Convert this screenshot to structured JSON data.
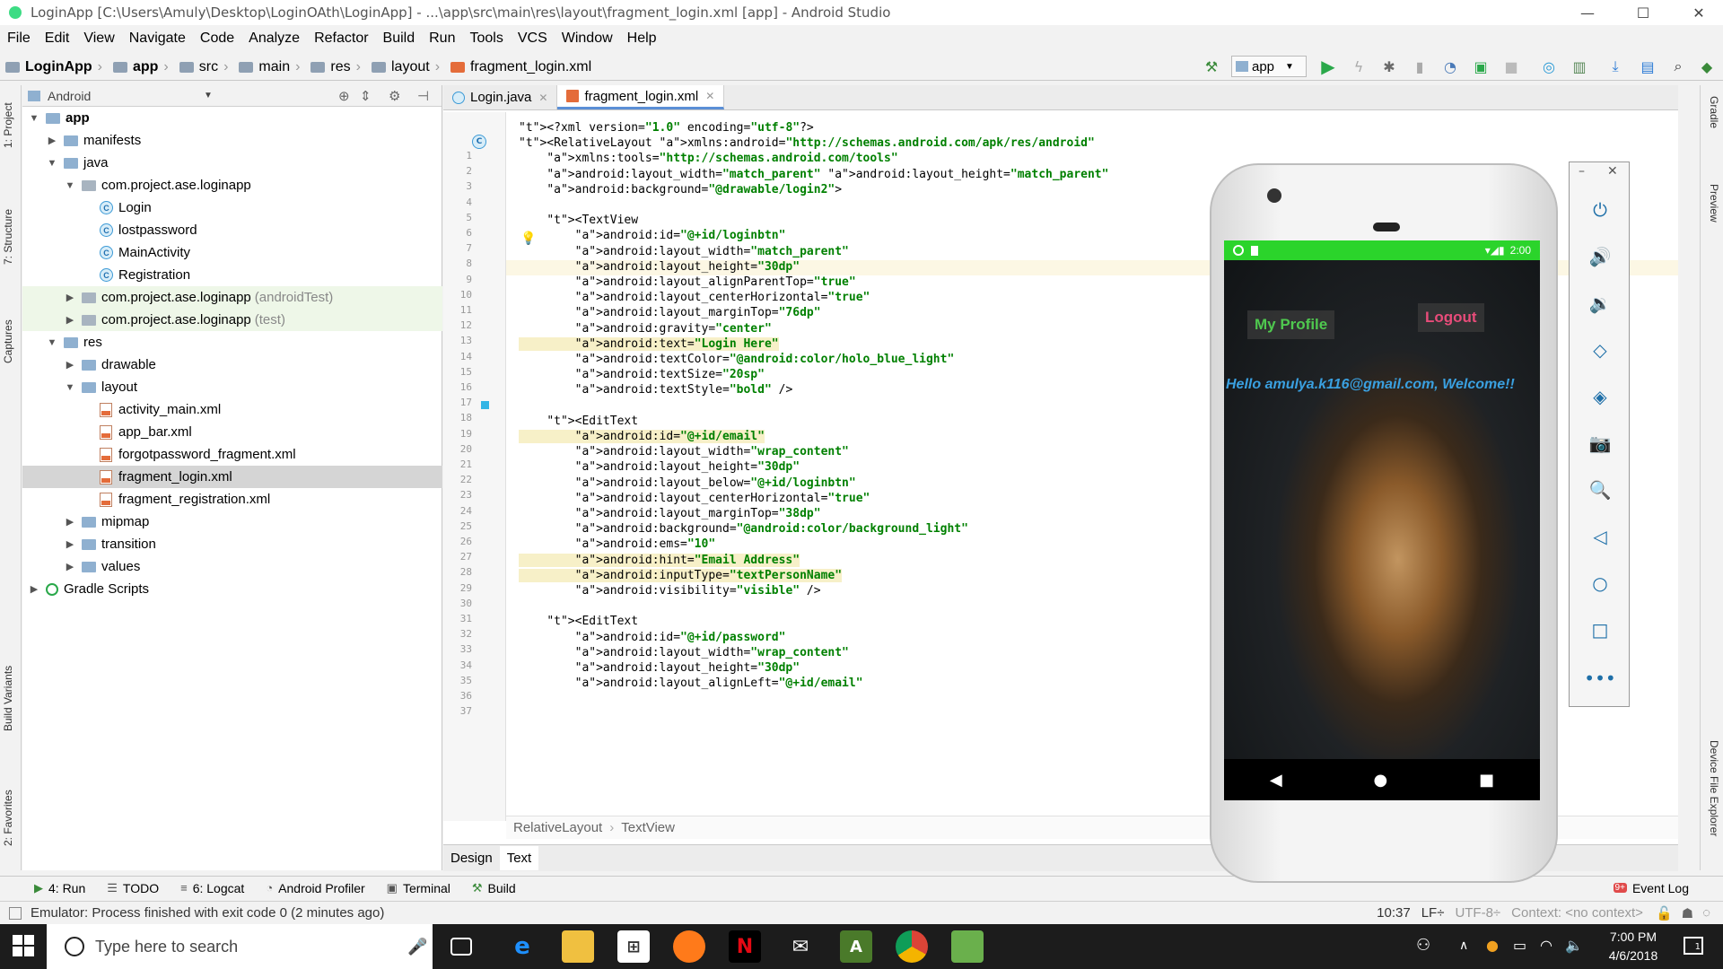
{
  "window": {
    "title": "LoginApp [C:\\Users\\Amuly\\Desktop\\LoginOAth\\LoginApp] - ...\\app\\src\\main\\res\\layout\\fragment_login.xml [app] - Android Studio"
  },
  "menu": [
    "File",
    "Edit",
    "View",
    "Navigate",
    "Code",
    "Analyze",
    "Refactor",
    "Build",
    "Run",
    "Tools",
    "VCS",
    "Window",
    "Help"
  ],
  "breadcrumb": [
    "LoginApp",
    "app",
    "src",
    "main",
    "res",
    "layout",
    "fragment_login.xml"
  ],
  "run_config": "app",
  "project_panel": {
    "view_mode": "Android",
    "tree": [
      {
        "label": "app",
        "type": "module",
        "level": 0,
        "expanded": true
      },
      {
        "label": "manifests",
        "type": "folder",
        "level": 1,
        "expanded": false
      },
      {
        "label": "java",
        "type": "folder",
        "level": 1,
        "expanded": true
      },
      {
        "label": "com.project.ase.loginapp",
        "type": "package",
        "level": 2,
        "expanded": true
      },
      {
        "label": "Login",
        "type": "class",
        "level": 3
      },
      {
        "label": "lostpassword",
        "type": "class",
        "level": 3
      },
      {
        "label": "MainActivity",
        "type": "class",
        "level": 3
      },
      {
        "label": "Registration",
        "type": "class",
        "level": 3
      },
      {
        "label": "com.project.ase.loginapp",
        "suffix": "(androidTest)",
        "type": "package",
        "level": 2,
        "expanded": false
      },
      {
        "label": "com.project.ase.loginapp",
        "suffix": "(test)",
        "type": "package",
        "level": 2,
        "expanded": false
      },
      {
        "label": "res",
        "type": "folder",
        "level": 1,
        "expanded": true
      },
      {
        "label": "drawable",
        "type": "folder",
        "level": 2,
        "expanded": false
      },
      {
        "label": "layout",
        "type": "folder",
        "level": 2,
        "expanded": true
      },
      {
        "label": "activity_main.xml",
        "type": "xml",
        "level": 3
      },
      {
        "label": "app_bar.xml",
        "type": "xml",
        "level": 3
      },
      {
        "label": "forgotpassword_fragment.xml",
        "type": "xml",
        "level": 3
      },
      {
        "label": "fragment_login.xml",
        "type": "xml",
        "level": 3,
        "selected": true
      },
      {
        "label": "fragment_registration.xml",
        "type": "xml",
        "level": 3
      },
      {
        "label": "mipmap",
        "type": "folder",
        "level": 2,
        "expanded": false
      },
      {
        "label": "transition",
        "type": "folder",
        "level": 2,
        "expanded": false
      },
      {
        "label": "values",
        "type": "folder",
        "level": 2,
        "expanded": false
      },
      {
        "label": "Gradle Scripts",
        "type": "gradle",
        "level": 0,
        "expanded": false
      }
    ]
  },
  "editor": {
    "tabs": [
      {
        "label": "Login.java",
        "active": false
      },
      {
        "label": "fragment_login.xml",
        "active": true
      }
    ],
    "lines": [
      "<?xml version=\"1.0\" encoding=\"utf-8\"?>",
      "<RelativeLayout xmlns:android=\"http://schemas.android.com/apk/res/android\"",
      "    xmlns:tools=\"http://schemas.android.com/tools\"",
      "    android:layout_width=\"match_parent\" android:layout_height=\"match_parent\"",
      "    android:background=\"@drawable/login2\">",
      "",
      "    <TextView",
      "        android:id=\"@+id/loginbtn\"",
      "        android:layout_width=\"match_parent\"",
      "        android:layout_height=\"30dp\"",
      "        android:layout_alignParentTop=\"true\"",
      "        android:layout_centerHorizontal=\"true\"",
      "        android:layout_marginTop=\"76dp\"",
      "        android:gravity=\"center\"",
      "        android:text=\"Login Here\"",
      "        android:textColor=\"@android:color/holo_blue_light\"",
      "        android:textSize=\"20sp\"",
      "        android:textStyle=\"bold\" />",
      "",
      "    <EditText",
      "        android:id=\"@+id/email\"",
      "        android:layout_width=\"wrap_content\"",
      "        android:layout_height=\"30dp\"",
      "        android:layout_below=\"@+id/loginbtn\"",
      "        android:layout_centerHorizontal=\"true\"",
      "        android:layout_marginTop=\"38dp\"",
      "        android:background=\"@android:color/background_light\"",
      "        android:ems=\"10\"",
      "        android:hint=\"Email Address\"",
      "        android:inputType=\"textPersonName\"",
      "        android:visibility=\"visible\" />",
      "",
      "    <EditText",
      "        android:id=\"@+id/password\"",
      "        android:layout_width=\"wrap_content\"",
      "        android:layout_height=\"30dp\"",
      "        android:layout_alignLeft=\"@+id/email\""
    ],
    "current_line": 10,
    "highlighted_lines": [
      15,
      21,
      29,
      30
    ],
    "crumbs": [
      "RelativeLayout",
      "TextView"
    ],
    "design_tab": "Design",
    "text_tab": "Text"
  },
  "left_stripe": [
    "1: Project",
    "7: Structure",
    "Captures",
    "Build Variants",
    "2: Favorites"
  ],
  "right_stripe": [
    "Gradle",
    "Preview",
    "Device File Explorer"
  ],
  "bottom_tools": [
    {
      "label": "4: Run",
      "icon": "run-icon"
    },
    {
      "label": "TODO",
      "icon": "todo-icon"
    },
    {
      "label": "6: Logcat",
      "icon": "logcat-icon"
    },
    {
      "label": "Android Profiler",
      "icon": "profiler-icon"
    },
    {
      "label": "Terminal",
      "icon": "terminal-icon"
    },
    {
      "label": "Build",
      "icon": "build-icon"
    }
  ],
  "event_log": {
    "label": "Event Log",
    "count": "9+"
  },
  "status": {
    "message": "Emulator: Process finished with exit code 0 (2 minutes ago)",
    "position": "10:37",
    "line_sep": "LF÷",
    "encoding": "UTF-8÷",
    "context": "Context: <no context>"
  },
  "emulator": {
    "status_time": "2:00",
    "my_profile": "My Profile",
    "logout": "Logout",
    "welcome": "Hello amulya.k116@gmail.com, Welcome!!",
    "colors": {
      "status_bar": "#2bd42b",
      "profile": "#4fc94f",
      "logout": "#e84c7a",
      "welcome": "#3aa0e0"
    }
  },
  "taskbar": {
    "search_placeholder": "Type here to search",
    "time": "7:00 PM",
    "date": "4/6/2018",
    "notification_count": "1"
  }
}
